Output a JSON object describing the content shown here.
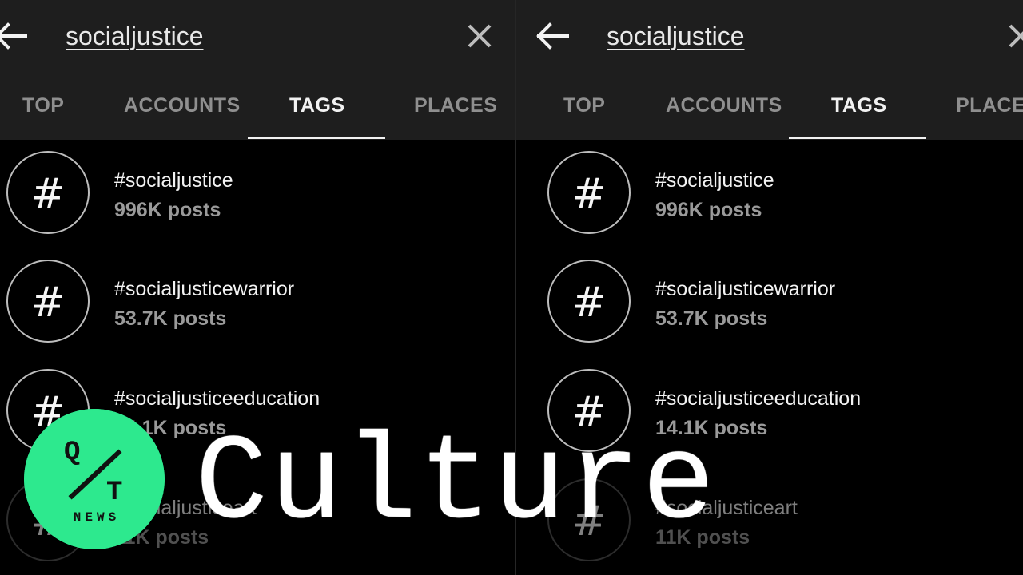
{
  "search": {
    "query": "socialjustice"
  },
  "tabs": [
    {
      "label": "TOP"
    },
    {
      "label": "ACCOUNTS"
    },
    {
      "label": "TAGS"
    },
    {
      "label": "PLACES"
    }
  ],
  "results": [
    {
      "tag": "#socialjustice",
      "count": "996K posts"
    },
    {
      "tag": "#socialjusticewarrior",
      "count": "53.7K posts"
    },
    {
      "tag": "#socialjusticeeducation",
      "count": "14.1K posts"
    },
    {
      "tag": "#socialjusticeart",
      "count": "11K posts"
    }
  ],
  "hash_symbol": "#",
  "overlay": {
    "logo_top": "Q",
    "logo_bottom": "T",
    "logo_footer": "NEWS",
    "title": "Culture"
  },
  "colors": {
    "background": "#000000",
    "header": "#1e1e1e",
    "accent": "#2de98e",
    "text": "#f2f2f2",
    "muted": "#8f8f8f"
  },
  "active_tab": "TAGS",
  "icons": {
    "back": "arrow-left-icon",
    "clear": "close-icon",
    "result": "hashtag-icon"
  }
}
